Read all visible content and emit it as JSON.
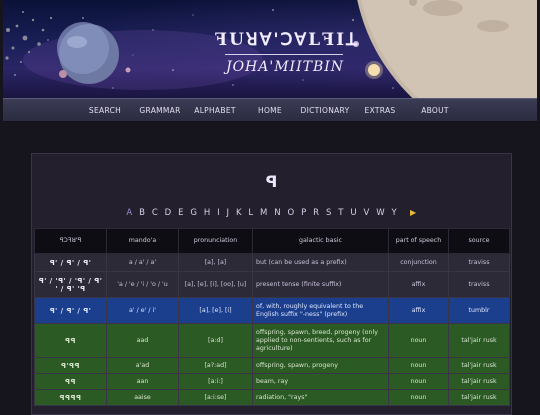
{
  "site": {
    "logo_glyphs": "ꟻUꓤꓯ'ꓛꓯLꟻIꓕ",
    "logo_name": "JOHA'MIITBIN"
  },
  "nav": {
    "items": [
      "SEARCH",
      "GRAMMAR",
      "ALPHABET",
      "HOME",
      "DICTIONARY",
      "EXTRAS",
      "ABOUT"
    ]
  },
  "page": {
    "current_letter_glyph": "ꟼ",
    "alphabet": [
      "A",
      "B",
      "C",
      "D",
      "E",
      "G",
      "H",
      "I",
      "J",
      "K",
      "L",
      "M",
      "N",
      "O",
      "P",
      "R",
      "S",
      "T",
      "U",
      "V",
      "W",
      "Y"
    ],
    "current_letter": "A",
    "next_arrow": "▶"
  },
  "table": {
    "headers": [
      "ꟼꓛꟻꓤ'ꟼ",
      "mando'a",
      "pronunciation",
      "galactic basic",
      "part of speech",
      "source"
    ],
    "rows": [
      {
        "style": "dark",
        "glyph": "ꟼ' / ꟼ' / ꟼ'",
        "mando": "a / a' / a'",
        "pron": "[a], [a]",
        "basic": "but (can be used as a prefix)",
        "pos": "conjunction",
        "source": "traviss"
      },
      {
        "style": "dark",
        "glyph": "ꟼ' / 'ꟼ' / 'ꟼ' / ꟼ' ' / ꟼ' 'ꟼ",
        "mando": "'a / 'e / 'i / 'o / 'u",
        "pron": "[a], [e], [i], [oo], [u]",
        "basic": "present tense (finite suffix)",
        "pos": "affix",
        "source": "traviss"
      },
      {
        "style": "blue",
        "glyph": "ꟼ' / ꟼ' / ꟼ'",
        "mando": "a' / e' / i'",
        "pron": "[a], [e], [i]",
        "basic": "of, with, roughly equivalent to the English suffix \"-ness\" (prefix)",
        "pos": "affix",
        "source": "tumblr"
      },
      {
        "style": "green",
        "glyph": "ꟼꟼ",
        "mando": "aad",
        "pron": "[a:d]",
        "basic": "offspring, spawn, breed, progeny (only applied to non-sentients, such as for agriculture)",
        "pos": "noun",
        "source": "tal'jair rusk"
      },
      {
        "style": "green",
        "glyph": "ꟼ'ꟼꟼ",
        "mando": "a'ad",
        "pron": "[a?:ad]",
        "basic": "offspring, spawn, progeny",
        "pos": "noun",
        "source": "tal'jair rusk"
      },
      {
        "style": "green",
        "glyph": "ꟼꟼ",
        "mando": "aan",
        "pron": "[a:i:]",
        "basic": "beam, ray",
        "pos": "noun",
        "source": "tal'jair rusk"
      },
      {
        "style": "green",
        "glyph": "ꟼꟼꟼꟼ",
        "mando": "aaise",
        "pron": "[a:i:se]",
        "basic": "radiation, \"rays\"",
        "pos": "noun",
        "source": "tal'jair rusk"
      }
    ]
  },
  "colors": {
    "blue_row": "#1b3f8c",
    "green_row": "#2c5a25",
    "arrow": "#e7b93c"
  }
}
